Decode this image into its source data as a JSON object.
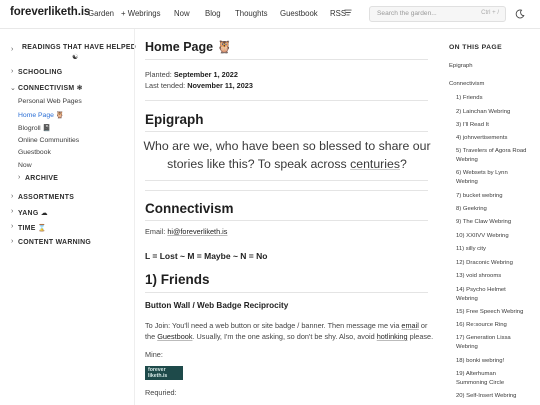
{
  "header": {
    "logo": "foreverliketh.is",
    "nav": [
      "Garden",
      "+ Webrings",
      "Now",
      "Blog",
      "Thoughts",
      "Guestbook",
      "RSS"
    ],
    "search_placeholder": "Search the garden...",
    "search_shortcut": "Ctrl + /"
  },
  "sidebar": {
    "readings": "READINGS THAT HAVE HELPED",
    "readings_icon": "☯",
    "schooling": "SCHOOLING",
    "connectivism": "CONNECTIVISM ❃",
    "connect_items": [
      "Personal Web Pages",
      "Home Page 🦉",
      "Blogroll 📓",
      "Online Communities",
      "Guestbook",
      "Now"
    ],
    "archive": "ARCHIVE",
    "assortments": "ASSORTMENTS",
    "yang": "YANG ☁",
    "time": "TIME ⌛",
    "content_warning": "CONTENT WARNING"
  },
  "main": {
    "title": "Home Page",
    "title_icon": "🦉",
    "planted_label": "Planted:",
    "planted_date": "September 1, 2022",
    "tended_label": "Last tended:",
    "tended_date": "November 11, 2023",
    "epigraph_heading": "Epigraph",
    "epigraph_line1": "Who are we, who have been so blessed to share our",
    "epigraph_line2a": "stories like this? To speak across",
    "epigraph_link": "centuries",
    "epigraph_line2b": "?",
    "connectivism_heading": "Connectivism",
    "email_label": "Email:",
    "email": "hi@foreverliketh.is",
    "legend": "L = Lost ~ M = Maybe ~ N = No",
    "friends_heading": "1) Friends",
    "button_wall": "Button Wall / Web Badge Reciprocity",
    "join_line1a": "To Join: You'll need a web button or site badge / banner. Then message me via",
    "join_email": "email",
    "join_line1b": "or",
    "join_line2a": "the",
    "join_guestbook": "Guestbook",
    "join_line2b": ". Usually, I'm the one asking, so don't be shy. Also, avoid",
    "join_hotlinking": "hotlinking",
    "join_line2c": "please.",
    "mine": "Mine:",
    "badge_text": "forever liketh.is",
    "required": "Requried:"
  },
  "toc": {
    "title": "ON THIS PAGE",
    "items": [
      {
        "label": "Epigraph",
        "level": 1
      },
      {
        "label": "Connectivism",
        "level": 1
      },
      {
        "label": "1) Friends",
        "level": 2
      },
      {
        "label": "2) Lainchan Webring",
        "level": 2
      },
      {
        "label": "3) I'll Read It",
        "level": 2
      },
      {
        "label": "4) johnvertisements",
        "level": 2
      },
      {
        "label": "5) Travelers of Agora Road",
        "label2": "Webring",
        "level": 2
      },
      {
        "label": "6) Websets by Lynn",
        "label2": "Webring",
        "level": 2
      },
      {
        "label": "7) bucket webring",
        "level": 2
      },
      {
        "label": "8) Geekring",
        "level": 2
      },
      {
        "label": "9) The Claw Webring",
        "level": 2
      },
      {
        "label": "10) XXIIVV Webring",
        "level": 2
      },
      {
        "label": "11) silly city",
        "level": 2
      },
      {
        "label": "12) Draconic Webring",
        "level": 2
      },
      {
        "label": "13) void shrooms",
        "level": 2
      },
      {
        "label": "14) Psycho Helmet",
        "label2": "Webring",
        "level": 2
      },
      {
        "label": "15) Free Speech Webring",
        "level": 2
      },
      {
        "label": "16) Re:source Ring",
        "level": 2
      },
      {
        "label": "17) Generation Lissa",
        "label2": "Webring",
        "level": 2
      },
      {
        "label": "18) bonki webring!",
        "level": 2
      },
      {
        "label": "19) Alterhuman",
        "label2": "Summoning Circle",
        "level": 2
      },
      {
        "label": "20) Self-Insert Webring",
        "level": 2
      }
    ]
  }
}
